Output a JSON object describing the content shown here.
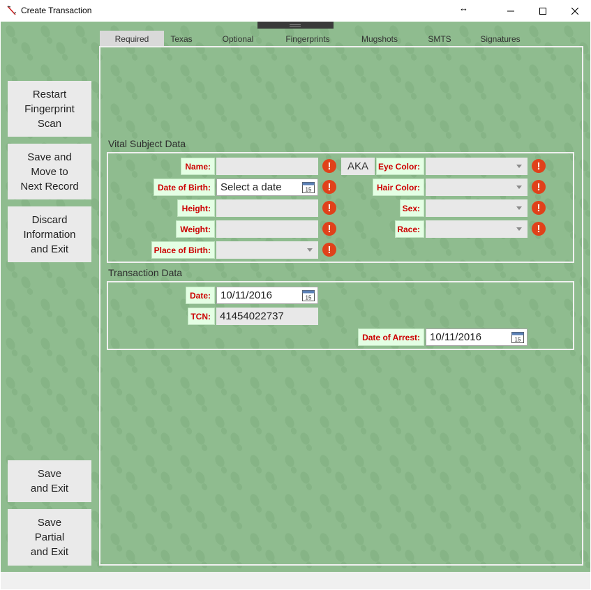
{
  "window": {
    "title": "Create Transaction",
    "resize_glyph": "↔"
  },
  "colors": {
    "background": "#8fbc8f",
    "label_text": "#cc0000",
    "label_bg": "#e4ffe4",
    "error": "#e0411a"
  },
  "sidebar": {
    "restart": "Restart\nFingerprint\nScan",
    "save_move": "Save and\nMove to\nNext Record",
    "discard": "Discard\nInformation\nand Exit",
    "save_exit": "Save\nand Exit",
    "save_partial": "Save\nPartial\nand Exit"
  },
  "tabs": [
    "Required",
    "Texas",
    "Optional",
    "Fingerprints",
    "Mugshots",
    "SMTS",
    "Signatures"
  ],
  "vital": {
    "title": "Vital Subject Data",
    "name_label": "Name:",
    "name_value": "",
    "aka": "AKA",
    "dob_label": "Date of Birth:",
    "dob_placeholder": "Select a date",
    "height_label": "Height:",
    "weight_label": "Weight:",
    "pob_label": "Place of Birth:",
    "eye_label": "Eye Color:",
    "hair_label": "Hair Color:",
    "sex_label": "Sex:",
    "race_label": "Race:",
    "error_glyph": "!"
  },
  "transaction": {
    "title": "Transaction Data",
    "date_label": "Date:",
    "date_value": "10/11/2016",
    "tcn_label": "TCN:",
    "tcn_value": "41454022737",
    "arrest_label": "Date of Arrest:",
    "arrest_value": "10/11/2016"
  },
  "calendar_day": "15"
}
